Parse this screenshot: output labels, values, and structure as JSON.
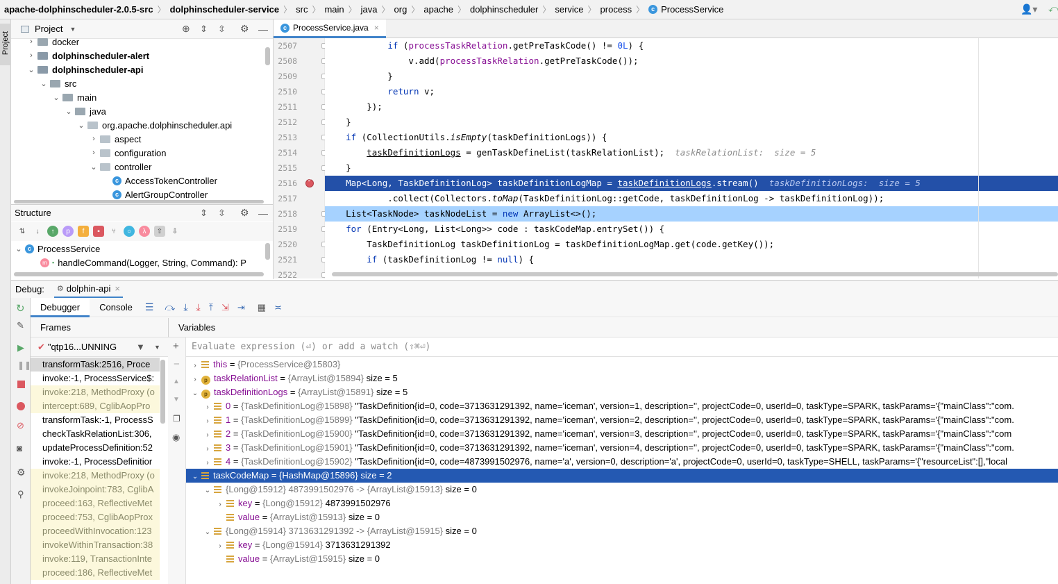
{
  "breadcrumb": [
    "apache-dolphinscheduler-2.0.5-src",
    "dolphinscheduler-service",
    "src",
    "main",
    "java",
    "org",
    "apache",
    "dolphinscheduler",
    "service",
    "process",
    "ProcessService"
  ],
  "left_stripe": {
    "project_label": "Project"
  },
  "project_panel": {
    "title": "Project",
    "tree": [
      {
        "label": "docker",
        "bold": false,
        "indent": 0,
        "arrow": "›",
        "icon": "folder"
      },
      {
        "label": "dolphinscheduler-alert",
        "bold": true,
        "indent": 0,
        "arrow": "›",
        "icon": "module-folder"
      },
      {
        "label": "dolphinscheduler-api",
        "bold": true,
        "indent": 0,
        "arrow": "⌄",
        "icon": "module-folder"
      },
      {
        "label": "src",
        "bold": false,
        "indent": 1,
        "arrow": "⌄",
        "icon": "folder"
      },
      {
        "label": "main",
        "bold": false,
        "indent": 2,
        "arrow": "⌄",
        "icon": "folder"
      },
      {
        "label": "java",
        "bold": false,
        "indent": 3,
        "arrow": "⌄",
        "icon": "folder"
      },
      {
        "label": "org.apache.dolphinscheduler.api",
        "bold": false,
        "indent": 4,
        "arrow": "⌄",
        "icon": "package"
      },
      {
        "label": "aspect",
        "bold": false,
        "indent": 5,
        "arrow": "›",
        "icon": "package"
      },
      {
        "label": "configuration",
        "bold": false,
        "indent": 5,
        "arrow": "›",
        "icon": "package"
      },
      {
        "label": "controller",
        "bold": false,
        "indent": 5,
        "arrow": "⌄",
        "icon": "package"
      },
      {
        "label": "AccessTokenController",
        "bold": false,
        "indent": 6,
        "arrow": "",
        "icon": "class"
      },
      {
        "label": "AlertGroupController",
        "bold": false,
        "indent": 6,
        "arrow": "",
        "icon": "class"
      }
    ]
  },
  "structure_panel": {
    "title": "Structure",
    "items": [
      {
        "label": "ProcessService",
        "icon": "class"
      },
      {
        "label": "handleCommand(Logger, String, Command): P",
        "icon": "method"
      }
    ]
  },
  "editor": {
    "tab": "ProcessService.java",
    "line_numbers": [
      "2507",
      "2508",
      "2509",
      "2510",
      "2511",
      "2512",
      "2513",
      "2514",
      "2515",
      "2516",
      "2517",
      "2518",
      "2519",
      "2520",
      "2521",
      "2522"
    ],
    "lines": {
      "l2507": "            if (processTaskRelation.getPreTaskCode() != 0L) {",
      "l2508": "                v.add(processTaskRelation.getPreTaskCode());",
      "l2509": "            }",
      "l2510": "            return v;",
      "l2511": "        });",
      "l2512": "    }",
      "l2513": "    if (CollectionUtils.isEmpty(taskDefinitionLogs)) {",
      "l2514": "        taskDefinitionLogs = genTaskDefineList(taskRelationList);",
      "l2515": "    }",
      "l2516": "    Map<Long, TaskDefinitionLog> taskDefinitionLogMap = taskDefinitionLogs.stream()",
      "l2517": "            .collect(Collectors.toMap(TaskDefinitionLog::getCode, taskDefinitionLog -> taskDefinitionLog));",
      "l2518": "    List<TaskNode> taskNodeList = new ArrayList<>();",
      "l2519": "    for (Entry<Long, List<Long>> code : taskCodeMap.entrySet()) {",
      "l2520": "        TaskDefinitionLog taskDefinitionLog = taskDefinitionLogMap.get(code.getKey());",
      "l2521": "        if (taskDefinitionLog != null) {"
    },
    "hints": {
      "h2514": "taskRelationList:  size = 5",
      "h2516": "taskDefinitionLogs:  size = 5"
    }
  },
  "debug": {
    "label": "Debug:",
    "session": "dolphin-api",
    "tabs": [
      "Debugger",
      "Console"
    ],
    "frames_title": "Frames",
    "variables_title": "Variables",
    "thread": "\"qtp16...UNNING",
    "eval_placeholder": "Evaluate expression (⏎) or add a watch (⇧⌘⏎)",
    "frames": [
      {
        "label": "transformTask:2516, Proce",
        "lib": false,
        "selected": true
      },
      {
        "label": "invoke:-1, ProcessService$:",
        "lib": false,
        "selected": false
      },
      {
        "label": "invoke:218, MethodProxy (o",
        "lib": true,
        "selected": false
      },
      {
        "label": "intercept:689, CglibAopPro",
        "lib": true,
        "selected": false
      },
      {
        "label": "transformTask:-1, ProcessS",
        "lib": false,
        "selected": false
      },
      {
        "label": "checkTaskRelationList:306,",
        "lib": false,
        "selected": false
      },
      {
        "label": "updateProcessDefinition:52",
        "lib": false,
        "selected": false
      },
      {
        "label": "invoke:-1, ProcessDefinitior",
        "lib": false,
        "selected": false
      },
      {
        "label": "invoke:218, MethodProxy (o",
        "lib": true,
        "selected": false
      },
      {
        "label": "invokeJoinpoint:783, CglibA",
        "lib": true,
        "selected": false
      },
      {
        "label": "proceed:163, ReflectiveMet",
        "lib": true,
        "selected": false
      },
      {
        "label": "proceed:753, CglibAopProx",
        "lib": true,
        "selected": false
      },
      {
        "label": "proceedWithInvocation:123",
        "lib": true,
        "selected": false
      },
      {
        "label": "invokeWithinTransaction:38",
        "lib": true,
        "selected": false
      },
      {
        "label": "invoke:119, TransactionInte",
        "lib": true,
        "selected": false
      },
      {
        "label": "proceed:186, ReflectiveMet",
        "lib": true,
        "selected": false
      }
    ],
    "variables": [
      {
        "indent": 0,
        "arrow": "›",
        "icon": "field",
        "name": "this",
        "type": "{ProcessService@15803}",
        "value": "",
        "selected": false
      },
      {
        "indent": 0,
        "arrow": "›",
        "icon": "param",
        "name": "taskRelationList",
        "type": "{ArrayList@15894}",
        "value": "size = 5",
        "selected": false
      },
      {
        "indent": 0,
        "arrow": "⌄",
        "icon": "param",
        "name": "taskDefinitionLogs",
        "type": "{ArrayList@15891}",
        "value": "size = 5",
        "selected": false
      },
      {
        "indent": 1,
        "arrow": "›",
        "icon": "field",
        "name": "0",
        "type": "{TaskDefinitionLog@15898}",
        "value": "\"TaskDefinition{id=0, code=3713631291392, name='iceman', version=1, description='', projectCode=0, userId=0, taskType=SPARK, taskParams='{\"mainClass\":\"com.",
        "selected": false
      },
      {
        "indent": 1,
        "arrow": "›",
        "icon": "field",
        "name": "1",
        "type": "{TaskDefinitionLog@15899}",
        "value": "\"TaskDefinition{id=0, code=3713631291392, name='iceman', version=2, description='', projectCode=0, userId=0, taskType=SPARK, taskParams='{\"mainClass\":\"com.",
        "selected": false
      },
      {
        "indent": 1,
        "arrow": "›",
        "icon": "field",
        "name": "2",
        "type": "{TaskDefinitionLog@15900}",
        "value": "\"TaskDefinition{id=0, code=3713631291392, name='iceman', version=3, description='', projectCode=0, userId=0, taskType=SPARK, taskParams='{\"mainClass\":\"com",
        "selected": false
      },
      {
        "indent": 1,
        "arrow": "›",
        "icon": "field",
        "name": "3",
        "type": "{TaskDefinitionLog@15901}",
        "value": "\"TaskDefinition{id=0, code=3713631291392, name='iceman', version=4, description='', projectCode=0, userId=0, taskType=SPARK, taskParams='{\"mainClass\":\"com.",
        "selected": false
      },
      {
        "indent": 1,
        "arrow": "›",
        "icon": "field",
        "name": "4",
        "type": "{TaskDefinitionLog@15902}",
        "value": "\"TaskDefinition{id=0, code=4873991502976, name='a', version=0, description='a', projectCode=0, userId=0, taskType=SHELL, taskParams='{\"resourceList\":[],\"local",
        "selected": false
      },
      {
        "indent": 0,
        "arrow": "⌄",
        "icon": "field",
        "name": "taskCodeMap",
        "type": "{HashMap@15896}",
        "value": "size = 2",
        "selected": true
      },
      {
        "indent": 1,
        "arrow": "⌄",
        "icon": "field",
        "name": "",
        "type": "{Long@15912} 4873991502976 -> {ArrayList@15913}",
        "value": "size = 0",
        "selected": false
      },
      {
        "indent": 2,
        "arrow": "›",
        "icon": "field",
        "name": "key",
        "type": "{Long@15912}",
        "value": "4873991502976",
        "selected": false
      },
      {
        "indent": 2,
        "arrow": "",
        "icon": "field",
        "name": "value",
        "type": "{ArrayList@15913}",
        "value": "size = 0",
        "selected": false
      },
      {
        "indent": 1,
        "arrow": "⌄",
        "icon": "field",
        "name": "",
        "type": "{Long@15914} 3713631291392 -> {ArrayList@15915}",
        "value": "size = 0",
        "selected": false
      },
      {
        "indent": 2,
        "arrow": "›",
        "icon": "field",
        "name": "key",
        "type": "{Long@15914}",
        "value": "3713631291392",
        "selected": false
      },
      {
        "indent": 2,
        "arrow": "",
        "icon": "field",
        "name": "value",
        "type": "{ArrayList@15915}",
        "value": "size = 0",
        "selected": false
      }
    ]
  },
  "colors": {
    "selection": "#2350a8",
    "current_line": "#a6d2ff",
    "breakpoint": "#db5860",
    "keyword": "#0033b3",
    "field": "#871094"
  }
}
